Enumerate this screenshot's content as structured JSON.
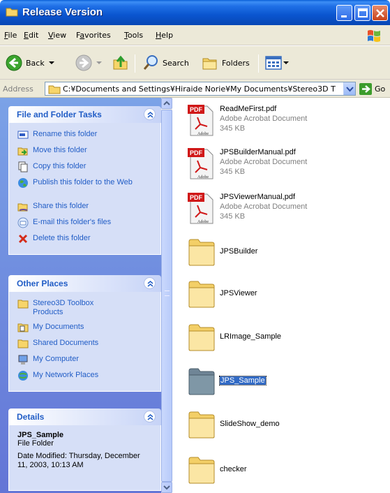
{
  "window": {
    "title": "Release Version",
    "icons": {
      "title": "folder-icon",
      "minimize": "minimize-icon",
      "maximize": "maximize-icon",
      "close": "close-icon"
    }
  },
  "menubar": {
    "items": [
      {
        "key": "F",
        "rest": "ile"
      },
      {
        "key": "E",
        "rest": "dit"
      },
      {
        "key": "V",
        "rest": "iew"
      },
      {
        "key": "a",
        "pre": "F",
        "rest": "vorites"
      },
      {
        "key": "T",
        "rest": "ools"
      },
      {
        "key": "H",
        "rest": "elp"
      }
    ]
  },
  "toolbar": {
    "back": "Back",
    "search": "Search",
    "folders": "Folders"
  },
  "address": {
    "label": "Address",
    "value": "C:¥Documents and Settings¥Hiraide Norie¥My Documents¥Stereo3D T",
    "go": "Go"
  },
  "tasks_panel": {
    "title": "File and Folder Tasks",
    "items": [
      {
        "label": "Rename this folder",
        "icon": "rename-icon"
      },
      {
        "label": "Move this folder",
        "icon": "move-icon"
      },
      {
        "label": "Copy this folder",
        "icon": "copy-icon"
      },
      {
        "label": "Publish this folder to the Web",
        "icon": "globe-icon"
      },
      {
        "label": "Share this folder",
        "icon": "share-icon"
      },
      {
        "label": "E-mail this folder's files",
        "icon": "email-icon"
      },
      {
        "label": "Delete this folder",
        "icon": "delete-icon"
      }
    ]
  },
  "places_panel": {
    "title": "Other Places",
    "items": [
      {
        "label": "Stereo3D Toolbox Products",
        "icon": "folder-icon"
      },
      {
        "label": "My Documents",
        "icon": "my-documents-icon"
      },
      {
        "label": "Shared Documents",
        "icon": "folder-icon"
      },
      {
        "label": "My Computer",
        "icon": "computer-icon"
      },
      {
        "label": "My Network Places",
        "icon": "network-icon"
      }
    ]
  },
  "details_panel": {
    "title": "Details",
    "name": "JPS_Sample",
    "type": "File Folder",
    "date": "Date Modified: Thursday, December 11, 2003, 10:13 AM"
  },
  "files": [
    {
      "name": "ReadMeFirst.pdf",
      "type": "Adobe Acrobat Document",
      "size": "345 KB",
      "kind": "pdf"
    },
    {
      "name": "JPSBuilderManual.pdf",
      "type": "Adobe Acrobat Document",
      "size": "345 KB",
      "kind": "pdf"
    },
    {
      "name": "JPSViewerManual,pdf",
      "type": "Adobe Acrobat Document",
      "size": "345 KB",
      "kind": "pdf"
    },
    {
      "name": "JPSBuilder",
      "kind": "folder"
    },
    {
      "name": "JPSViewer",
      "kind": "folder"
    },
    {
      "name": "LRImage_Sample",
      "kind": "folder"
    },
    {
      "name": "JPS_Sample",
      "kind": "folder",
      "selected": true
    },
    {
      "name": "SlideShow_demo",
      "kind": "folder"
    },
    {
      "name": "checker",
      "kind": "folder"
    }
  ],
  "pdf_icon": {
    "badge": "PDF",
    "brand": "Adobe"
  }
}
